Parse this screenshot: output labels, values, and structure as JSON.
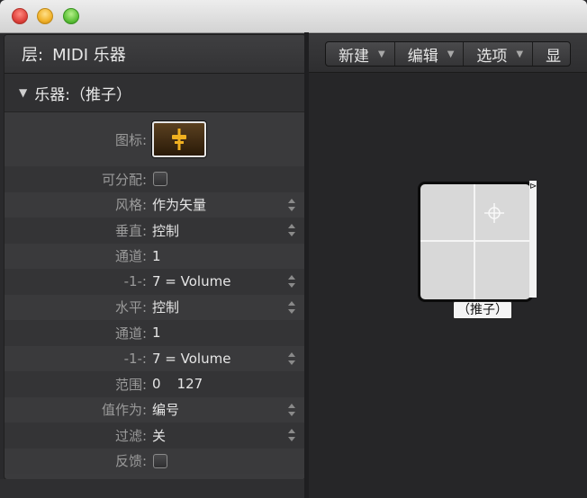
{
  "window": {
    "controls": [
      "close",
      "minimize",
      "zoom"
    ]
  },
  "inspector": {
    "layer_label": "层:",
    "layer_value": "MIDI 乐器",
    "section_title": "乐器:（推子）",
    "props": {
      "icon_label": "图标:",
      "assignable_label": "可分配:",
      "style_label": "风格:",
      "style_value": "作为矢量",
      "vertical_label": "垂直:",
      "vertical_value": "控制",
      "channel1_label": "通道:",
      "channel1_value": "1",
      "cc1_label": "-1-:",
      "cc1_value": "7 = Volume",
      "horizontal_label": "水平:",
      "horizontal_value": "控制",
      "channel2_label": "通道:",
      "channel2_value": "1",
      "cc2_label": "-1-:",
      "cc2_value": "7 = Volume",
      "range_label": "范围:",
      "range_min": "0",
      "range_max": "127",
      "value_as_label": "值作为:",
      "value_as_value": "编号",
      "filter_label": "过滤:",
      "filter_value": "关",
      "feedback_label": "反馈:"
    }
  },
  "toolbar": {
    "new_label": "新建",
    "edit_label": "编辑",
    "options_label": "选项",
    "view_label": "显"
  },
  "canvas": {
    "fader_label": "（推子）"
  },
  "colors": {
    "accent_icon": "#f0b020",
    "panel": "#3b3b3d",
    "canvas": "#262628"
  }
}
